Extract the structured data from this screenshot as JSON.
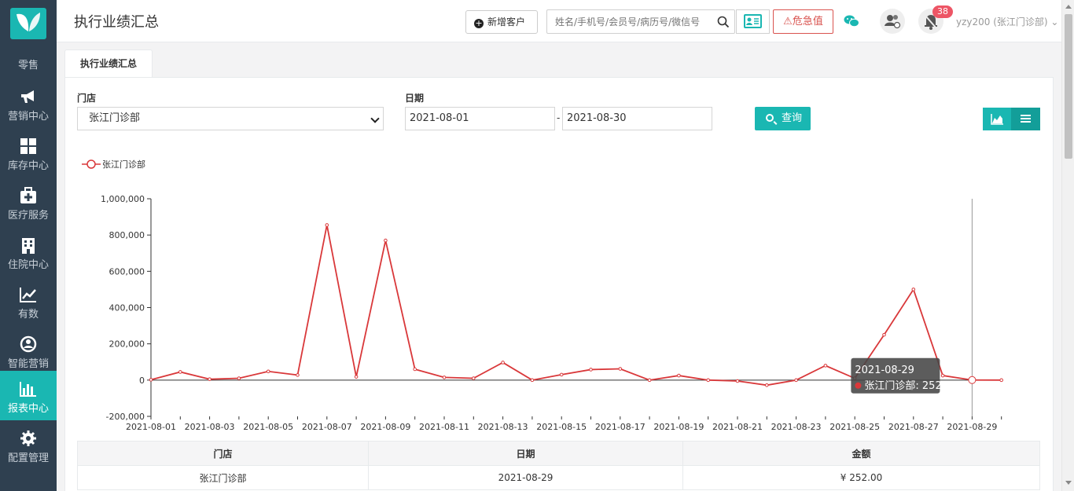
{
  "sidebar": {
    "top_label": "零售",
    "items": [
      {
        "label": "营销中心",
        "icon": "megaphone-icon"
      },
      {
        "label": "库存中心",
        "icon": "grid-icon"
      },
      {
        "label": "医疗服务",
        "icon": "medical-kit-icon"
      },
      {
        "label": "住院中心",
        "icon": "hospital-icon"
      },
      {
        "label": "有数",
        "icon": "line-chart-icon"
      },
      {
        "label": "智能营销",
        "icon": "smart-marketing-icon"
      },
      {
        "label": "报表中心",
        "icon": "bar-chart-icon"
      },
      {
        "label": "配置管理",
        "icon": "gear-icon"
      }
    ],
    "active_color": "#1ab7b2"
  },
  "header": {
    "title": "执行业绩汇总",
    "new_customer_label": "新增客户",
    "search_placeholder": "姓名/手机号/会员号/病历号/微信号",
    "danger_label": "危急值",
    "notification_count": "38",
    "user_label": "yzy200 (张江门诊部)"
  },
  "tab": {
    "label": "执行业绩汇总"
  },
  "filters": {
    "store_label": "门店",
    "store_value": "张江门诊部",
    "date_label": "日期",
    "date_from": "2021-08-01",
    "date_to": "2021-08-30",
    "date_separator": "-",
    "query_label": "查询"
  },
  "chart_data": {
    "type": "line",
    "legend": "张江门诊部",
    "color": "#d9383a",
    "ylim": [
      -200000,
      1000000
    ],
    "y_ticks": [
      -200000,
      0,
      200000,
      400000,
      600000,
      800000,
      1000000
    ],
    "y_tick_labels": [
      "-200,000",
      "0",
      "200,000",
      "400,000",
      "600,000",
      "800,000",
      "1,000,000"
    ],
    "x": [
      "2021-08-01",
      "2021-08-02",
      "2021-08-03",
      "2021-08-04",
      "2021-08-05",
      "2021-08-06",
      "2021-08-07",
      "2021-08-08",
      "2021-08-09",
      "2021-08-10",
      "2021-08-11",
      "2021-08-12",
      "2021-08-13",
      "2021-08-14",
      "2021-08-15",
      "2021-08-16",
      "2021-08-17",
      "2021-08-18",
      "2021-08-19",
      "2021-08-20",
      "2021-08-21",
      "2021-08-22",
      "2021-08-23",
      "2021-08-24",
      "2021-08-25",
      "2021-08-26",
      "2021-08-27",
      "2021-08-28",
      "2021-08-29",
      "2021-08-30"
    ],
    "x_tick_labels": [
      "2021-08-01",
      "2021-08-03",
      "2021-08-05",
      "2021-08-07",
      "2021-08-09",
      "2021-08-11",
      "2021-08-13",
      "2021-08-15",
      "2021-08-17",
      "2021-08-19",
      "2021-08-21",
      "2021-08-23",
      "2021-08-25",
      "2021-08-27",
      "2021-08-29"
    ],
    "values": [
      2000,
      45000,
      5000,
      10000,
      48000,
      28000,
      855000,
      18000,
      770000,
      60000,
      15000,
      10000,
      97000,
      0,
      30000,
      58000,
      62000,
      0,
      25000,
      0,
      -5000,
      -28000,
      0,
      80000,
      10000,
      250000,
      500000,
      25000,
      252,
      0
    ],
    "tooltip": {
      "date": "2021-08-29",
      "label": "张江门诊部: 252"
    }
  },
  "table": {
    "headers": [
      "门店",
      "日期",
      "金额"
    ],
    "rows": [
      [
        "张江门诊部",
        "2021-08-29",
        "¥ 252.00"
      ]
    ]
  }
}
